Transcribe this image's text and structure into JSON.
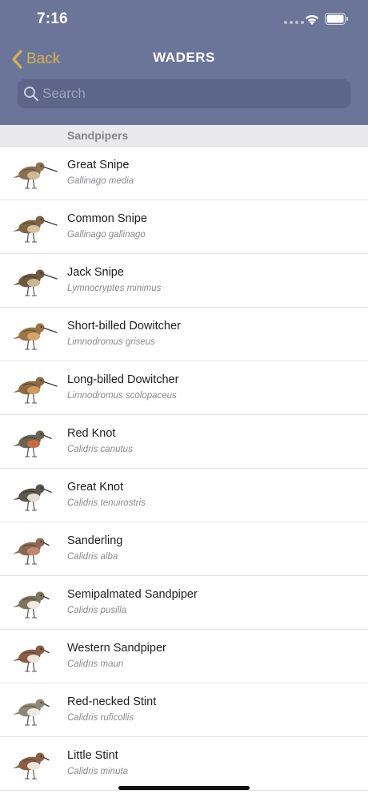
{
  "status_bar": {
    "time": "7:16"
  },
  "nav": {
    "back_label": "Back",
    "title": "WADERS"
  },
  "search": {
    "placeholder": "Search",
    "value": ""
  },
  "section": {
    "title": "Sandpipers"
  },
  "birds": [
    {
      "common": "Great Snipe",
      "latin": "Gallinago media",
      "icon": "snipe-illustration",
      "body": "#8a7154",
      "breast": "#cdbb95",
      "bill": "long"
    },
    {
      "common": "Common Snipe",
      "latin": "Gallinago gallinago",
      "icon": "snipe-illustration",
      "body": "#7f6649",
      "breast": "#d4c39d",
      "bill": "long"
    },
    {
      "common": "Jack Snipe",
      "latin": "Lymnocryptes minimus",
      "icon": "snipe-illustration",
      "body": "#6f5a40",
      "breast": "#c9b88f",
      "bill": "long"
    },
    {
      "common": "Short-billed Dowitcher",
      "latin": "Limnodromus griseus",
      "icon": "dowitcher-illustration",
      "body": "#9a7548",
      "breast": "#d7a56a",
      "bill": "long"
    },
    {
      "common": "Long-billed Dowitcher",
      "latin": "Limnodromus scolopaceus",
      "icon": "dowitcher-illustration",
      "body": "#8d6a42",
      "breast": "#cf9a5e",
      "bill": "long"
    },
    {
      "common": "Red Knot",
      "latin": "Calidris canutus",
      "icon": "knot-illustration",
      "body": "#6d6450",
      "breast": "#c86a45",
      "bill": "medium"
    },
    {
      "common": "Great Knot",
      "latin": "Calidris tenuirostris",
      "icon": "knot-illustration",
      "body": "#5a5650",
      "breast": "#e2ddd3",
      "bill": "medium"
    },
    {
      "common": "Sanderling",
      "latin": "Calidris alba",
      "icon": "sanderling-illustration",
      "body": "#8a6a55",
      "breast": "#c5876b",
      "bill": "short"
    },
    {
      "common": "Semipalmated Sandpiper",
      "latin": "Calidris pusilla",
      "icon": "sandpiper-illustration",
      "body": "#7b7560",
      "breast": "#efece2",
      "bill": "short"
    },
    {
      "common": "Western Sandpiper",
      "latin": "Calidris mauri",
      "icon": "sandpiper-illustration",
      "body": "#8b5c45",
      "breast": "#ece6da",
      "bill": "short"
    },
    {
      "common": "Red-necked Stint",
      "latin": "Calidris ruficollis",
      "icon": "stint-illustration",
      "body": "#8e8677",
      "breast": "#efebe3",
      "bill": "short"
    },
    {
      "common": "Little Stint",
      "latin": "Calidris minuta",
      "icon": "stint-illustration",
      "body": "#8a5f46",
      "breast": "#ede5d8",
      "bill": "short"
    }
  ],
  "colors": {
    "header": "#6a7599",
    "accent": "#d8b14a",
    "search_field": "#5b6689"
  }
}
